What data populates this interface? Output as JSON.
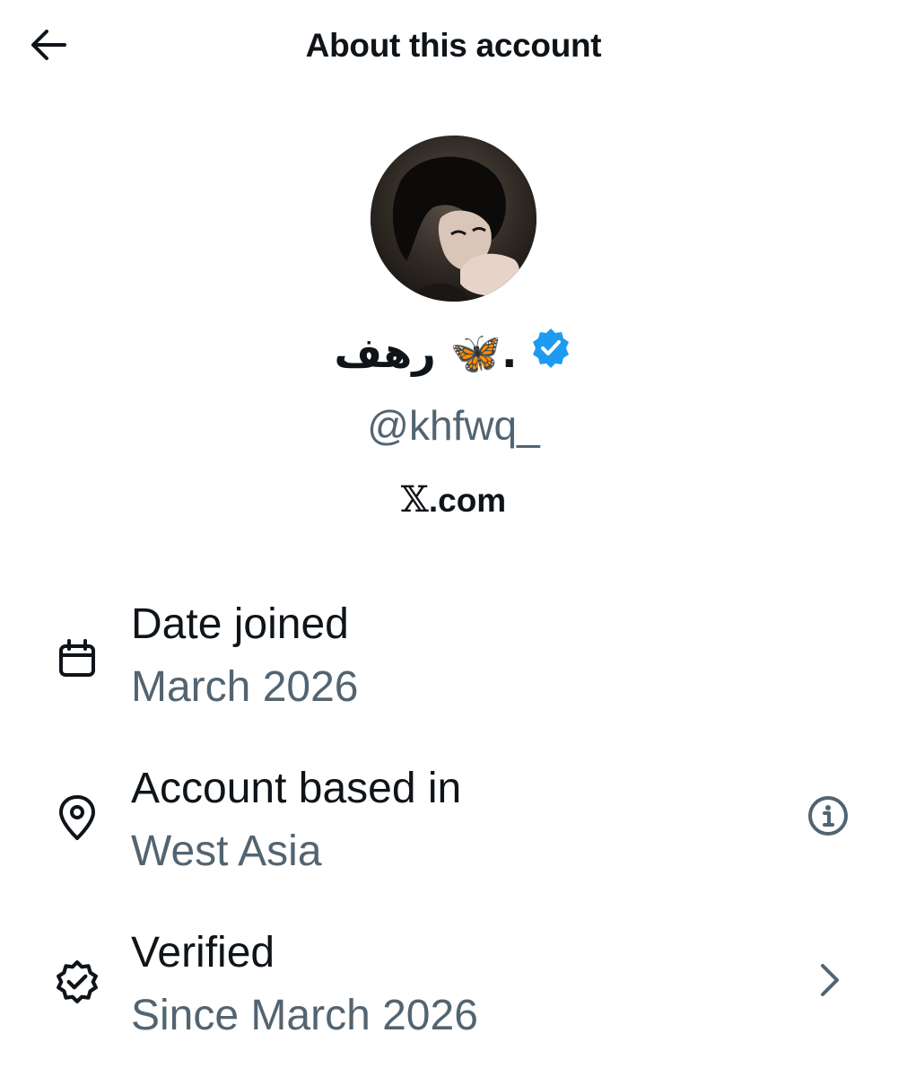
{
  "header": {
    "title": "About this account",
    "back_icon": "arrow-left-icon"
  },
  "profile": {
    "display_name": ".🦋 رهف",
    "verified_badge": "verified-badge-icon",
    "verified_color": "#1d9bf0",
    "handle": "@khfwq_",
    "site_mark": "𝕏",
    "site_suffix": ".com"
  },
  "details": [
    {
      "icon": "calendar-icon",
      "title": "Date joined",
      "value": "March 2026"
    },
    {
      "icon": "location-pin-icon",
      "title": "Account based in",
      "value": "West Asia",
      "action_icon": "info-icon"
    },
    {
      "icon": "verified-outline-icon",
      "title": "Verified",
      "value": "Since March 2026",
      "action_icon": "chevron-right-icon"
    }
  ],
  "colors": {
    "primary_text": "#0f1419",
    "secondary_text": "#536471",
    "accent": "#1d9bf0"
  }
}
